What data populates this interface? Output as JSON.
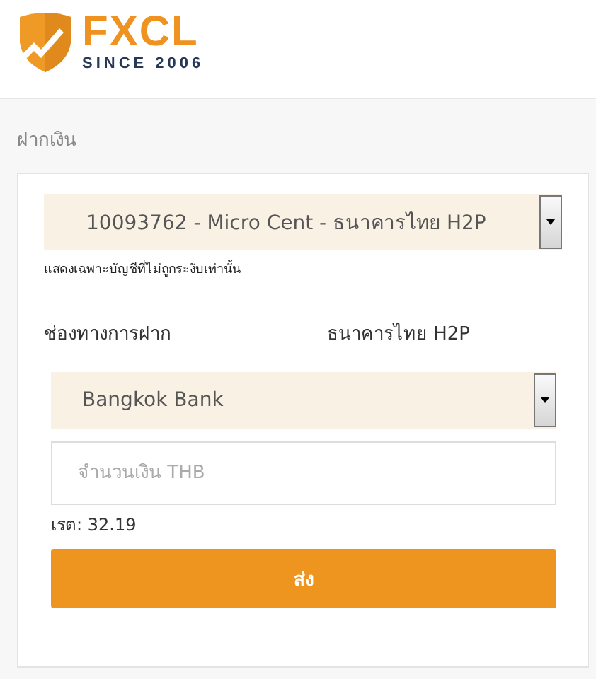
{
  "header": {
    "logo": {
      "name": "FXCL",
      "tagline": "SINCE 2006"
    }
  },
  "page_title": "ฝากเงิน",
  "account_select": {
    "value": "10093762 - Micro Cent - ธนาคารไทย H2P",
    "note": "แสดงเฉพาะบัญชีที่ไม่ถูกระงับเท่านั้น"
  },
  "deposit_channel": {
    "label": "ช่องทางการฝาก",
    "value": "ธนาคารไทย H2P"
  },
  "bank_select": {
    "value": "Bangkok Bank"
  },
  "amount_field": {
    "placeholder": "จำนวนเงิน THB"
  },
  "rate": "เรต: 32.19",
  "submit_button": "ส่ง"
}
